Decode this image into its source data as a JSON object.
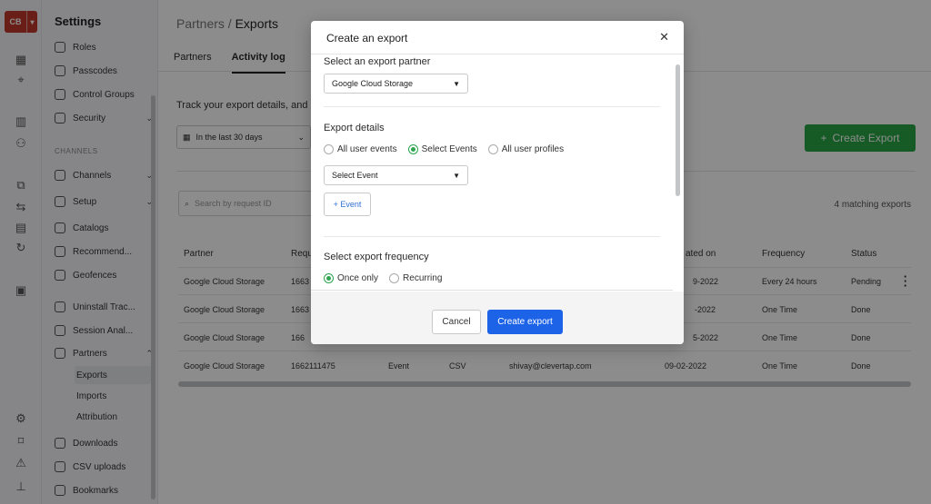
{
  "rail": {
    "logo": "CB",
    "logo_caret": "▾"
  },
  "sidebar": {
    "title": "Settings",
    "section": "CHANNELS",
    "items": [
      {
        "label": "Roles"
      },
      {
        "label": "Passcodes"
      },
      {
        "label": "Control Groups"
      },
      {
        "label": "Security",
        "caret": "⌄"
      },
      {
        "label": "Channels",
        "caret": "⌄"
      },
      {
        "label": "Setup",
        "caret": "⌄"
      },
      {
        "label": "Catalogs"
      },
      {
        "label": "Recommend..."
      },
      {
        "label": "Geofences"
      },
      {
        "label": "Uninstall Trac..."
      },
      {
        "label": "Session Anal..."
      },
      {
        "label": "Partners",
        "caret": "⌃"
      },
      {
        "label": "Exports"
      },
      {
        "label": "Imports"
      },
      {
        "label": "Attribution"
      },
      {
        "label": "Downloads"
      },
      {
        "label": "CSV uploads"
      },
      {
        "label": "Bookmarks"
      }
    ]
  },
  "breadcrumb": {
    "parent": "Partners /",
    "current": "Exports"
  },
  "tabs": [
    {
      "label": "Partners"
    },
    {
      "label": "Activity log"
    }
  ],
  "main": {
    "track_text": "Track your export details, and a",
    "date_filter": "In the last 30 days",
    "create_label": "Create Export",
    "search_placeholder": "Search by request ID",
    "matching": "4 matching exports"
  },
  "table": {
    "headers": [
      "Partner",
      "Requ",
      "",
      "",
      "",
      "ated on",
      "Frequency",
      "Status"
    ],
    "rows": [
      {
        "partner": "Google Cloud Storage",
        "req": "1663",
        "type": "",
        "fmt": "",
        "user": "",
        "date": "9-2022",
        "freq": "Every 24 hours",
        "status": "Pending"
      },
      {
        "partner": "Google Cloud Storage",
        "req": "1663",
        "type": "",
        "fmt": "",
        "user": "",
        "date": "-2022",
        "freq": "One Time",
        "status": "Done"
      },
      {
        "partner": "Google Cloud Storage",
        "req": "166",
        "type": "",
        "fmt": "",
        "user": "",
        "date": "5-2022",
        "freq": "One Time",
        "status": "Done"
      },
      {
        "partner": "Google Cloud Storage",
        "req": "1662111475",
        "type": "Event",
        "fmt": "CSV",
        "user": "shivay@clevertap.com",
        "date": "09-02-2022",
        "freq": "One Time",
        "status": "Done"
      }
    ]
  },
  "modal": {
    "title": "Create an export",
    "close": "✕",
    "partner_label": "Select an export partner",
    "partner_value": "Google Cloud Storage",
    "details_label": "Export details",
    "detail_options": [
      "All user events",
      "Select Events",
      "All user profiles"
    ],
    "detail_selected": "Select Events",
    "event_placeholder": "Select Event",
    "add_event": "+ Event",
    "frequency_label": "Select export frequency",
    "frequency_options": [
      "Once only",
      "Recurring"
    ],
    "frequency_selected": "Once only",
    "cancel": "Cancel",
    "create": "Create export"
  },
  "colors": {
    "accent": "#1c63e8",
    "success": "#29a745",
    "logo": "#c0392b"
  }
}
